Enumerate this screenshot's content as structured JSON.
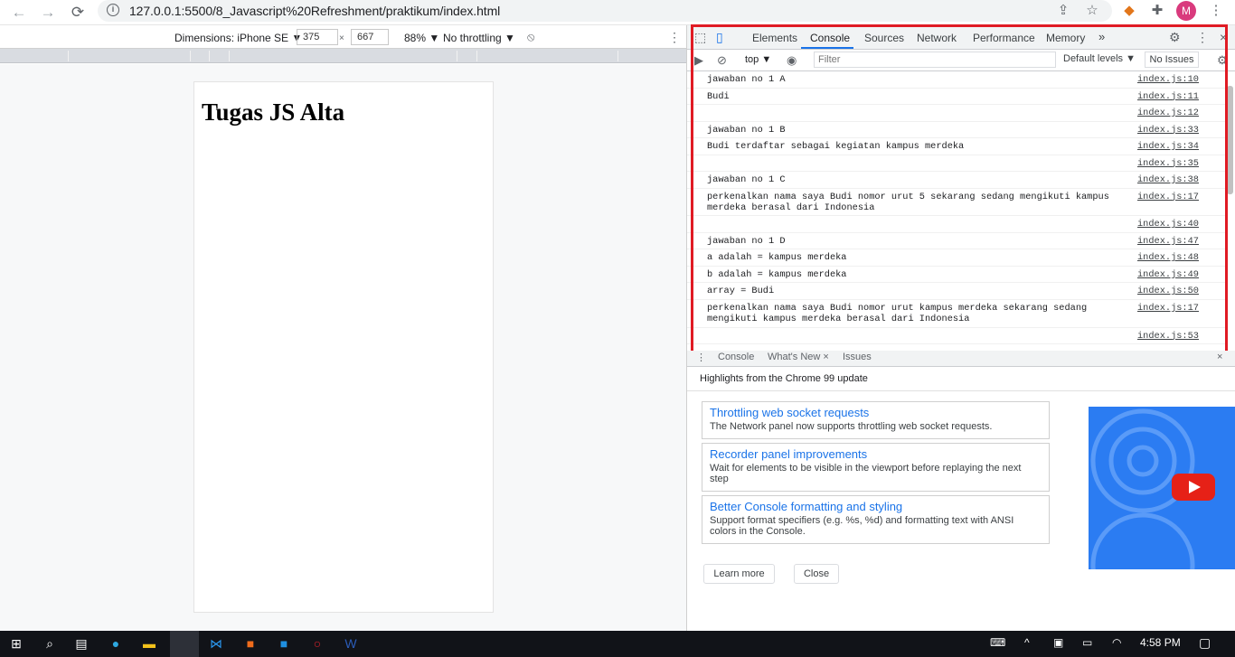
{
  "browser": {
    "url": "127.0.0.1:5500/8_Javascript%20Refreshment/praktikum/index.html",
    "profile_initial": "M"
  },
  "device_toolbar": {
    "dimensions": "Dimensions: iPhone SE ▼",
    "width": "375",
    "x": "×",
    "height": "667",
    "zoom": "88% ▼",
    "throttling": "No throttling ▼"
  },
  "page": {
    "heading": "Tugas JS Alta"
  },
  "devtools": {
    "tabs": [
      "Elements",
      "Console",
      "Sources",
      "Network",
      "Performance",
      "Memory"
    ],
    "more": "»",
    "context": "top ▼",
    "filter_placeholder": "Filter",
    "levels": "Default levels ▼",
    "no_issues": "No Issues",
    "console_rows": [
      {
        "msg": "jawaban no 1 A",
        "src": "index.js:10"
      },
      {
        "msg": "Budi",
        "src": "index.js:11"
      },
      {
        "msg": "",
        "src": "index.js:12"
      },
      {
        "msg": "jawaban no 1 B",
        "src": "index.js:33"
      },
      {
        "msg": "Budi terdaftar sebagai kegiatan kampus merdeka",
        "src": "index.js:34"
      },
      {
        "msg": "",
        "src": "index.js:35"
      },
      {
        "msg": "jawaban no 1 C",
        "src": "index.js:38"
      },
      {
        "msg": "perkenalkan nama saya Budi nomor urut 5 sekarang sedang mengikuti kampus merdeka berasal dari Indonesia",
        "src": "index.js:17"
      },
      {
        "msg": "",
        "src": "index.js:40"
      },
      {
        "msg": "jawaban no 1 D",
        "src": "index.js:47"
      },
      {
        "msg": "a adalah = kampus merdeka",
        "src": "index.js:48"
      },
      {
        "msg": "b adalah = kampus merdeka",
        "src": "index.js:49"
      },
      {
        "msg": "array = Budi",
        "src": "index.js:50"
      },
      {
        "msg": "perkenalkan nama saya Budi nomor urut kampus merdeka sekarang sedang mengikuti kampus merdeka berasal dari Indonesia",
        "src": "index.js:17"
      },
      {
        "msg": "",
        "src": "index.js:53"
      }
    ],
    "drawer_tabs": [
      "Console",
      "What's New ×",
      "Issues"
    ],
    "whats_new_title": "Highlights from the Chrome 99 update",
    "cards": [
      {
        "title": "Throttling web socket requests",
        "desc": "The Network panel now supports throttling web socket requests."
      },
      {
        "title": "Recorder panel improvements",
        "desc": "Wait for elements to be visible in the viewport before replaying the next step"
      },
      {
        "title": "Better Console formatting and styling",
        "desc": "Support format specifiers (e.g. %s, %d) and formatting text with ANSI colors in the Console."
      }
    ],
    "learn_more": "Learn more",
    "close": "Close"
  },
  "taskbar": {
    "time": "4:58 PM"
  },
  "colors": {
    "highlight_box": "#e01b24",
    "accent": "#1a73e8",
    "taskbar": "#111318"
  }
}
